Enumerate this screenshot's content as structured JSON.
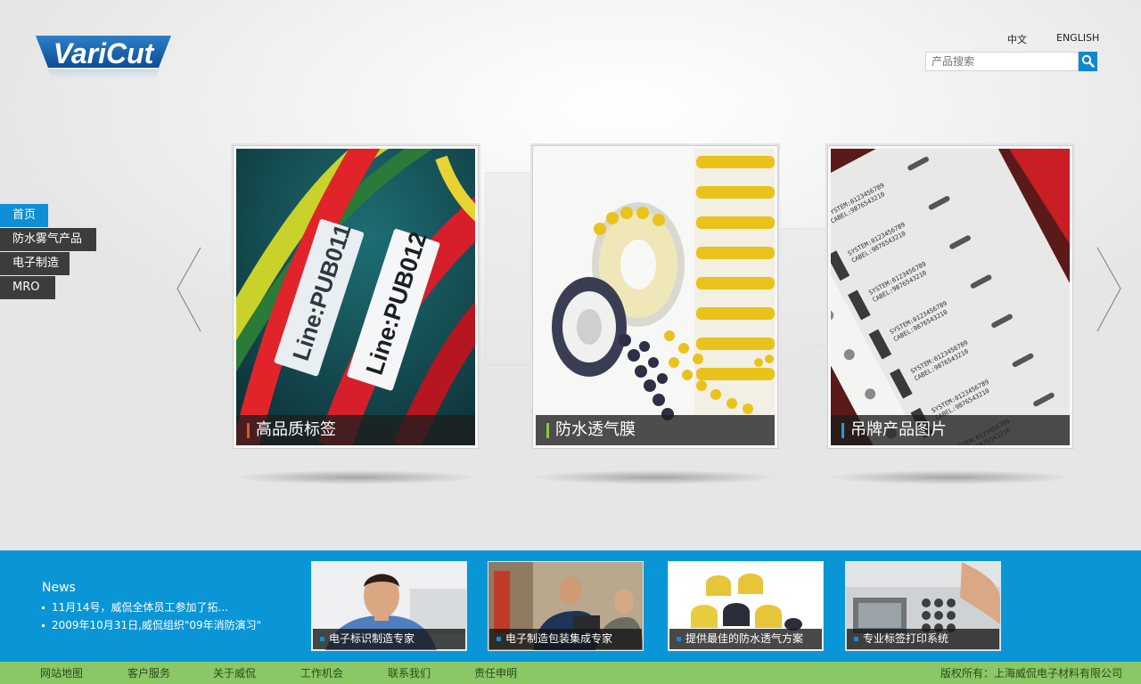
{
  "brand": {
    "logo_text": "VariCut",
    "accent": "#0e8fd6",
    "footer_green": "#8ac765"
  },
  "header": {
    "lang_zh": "中文",
    "lang_en": "ENGLISH",
    "search_placeholder": "产品搜索"
  },
  "nav": {
    "items": [
      {
        "label": "首页"
      },
      {
        "label": "防水雾气产品"
      },
      {
        "label": "电子制造"
      },
      {
        "label": "MRO"
      }
    ],
    "active_index": 0
  },
  "carousel": {
    "cards": [
      {
        "caption": "高品质标签",
        "bar_color": "#e2561b",
        "img_text_1": "Line:PUB011",
        "img_text_2": "Line:PUB012"
      },
      {
        "caption": "防水透气膜",
        "bar_color": "#8dc63f"
      },
      {
        "caption": "吊牌产品图片",
        "bar_color": "#2b9ad7",
        "img_line_a": "SYSTEM:0123456789",
        "img_line_b": "CABEL:9876543210"
      }
    ]
  },
  "news": {
    "title": "News",
    "items": [
      {
        "text": "11月14号，威侃全体员工参加了拓..."
      },
      {
        "text": "2009年10月31日,威侃组织\"09年消防演习\""
      }
    ]
  },
  "features": [
    {
      "caption": "电子标识制造专家"
    },
    {
      "caption": "电子制造包装集成专家"
    },
    {
      "caption": "提供最佳的防水透气方案"
    },
    {
      "caption": "专业标签打印系统"
    }
  ],
  "footer": {
    "links": [
      {
        "label": "网站地图"
      },
      {
        "label": "客户服务"
      },
      {
        "label": "关于威侃"
      },
      {
        "label": "工作机会"
      },
      {
        "label": "联系我们"
      },
      {
        "label": "责任申明"
      }
    ],
    "copyright": "版权所有：上海威侃电子材料有限公司"
  }
}
